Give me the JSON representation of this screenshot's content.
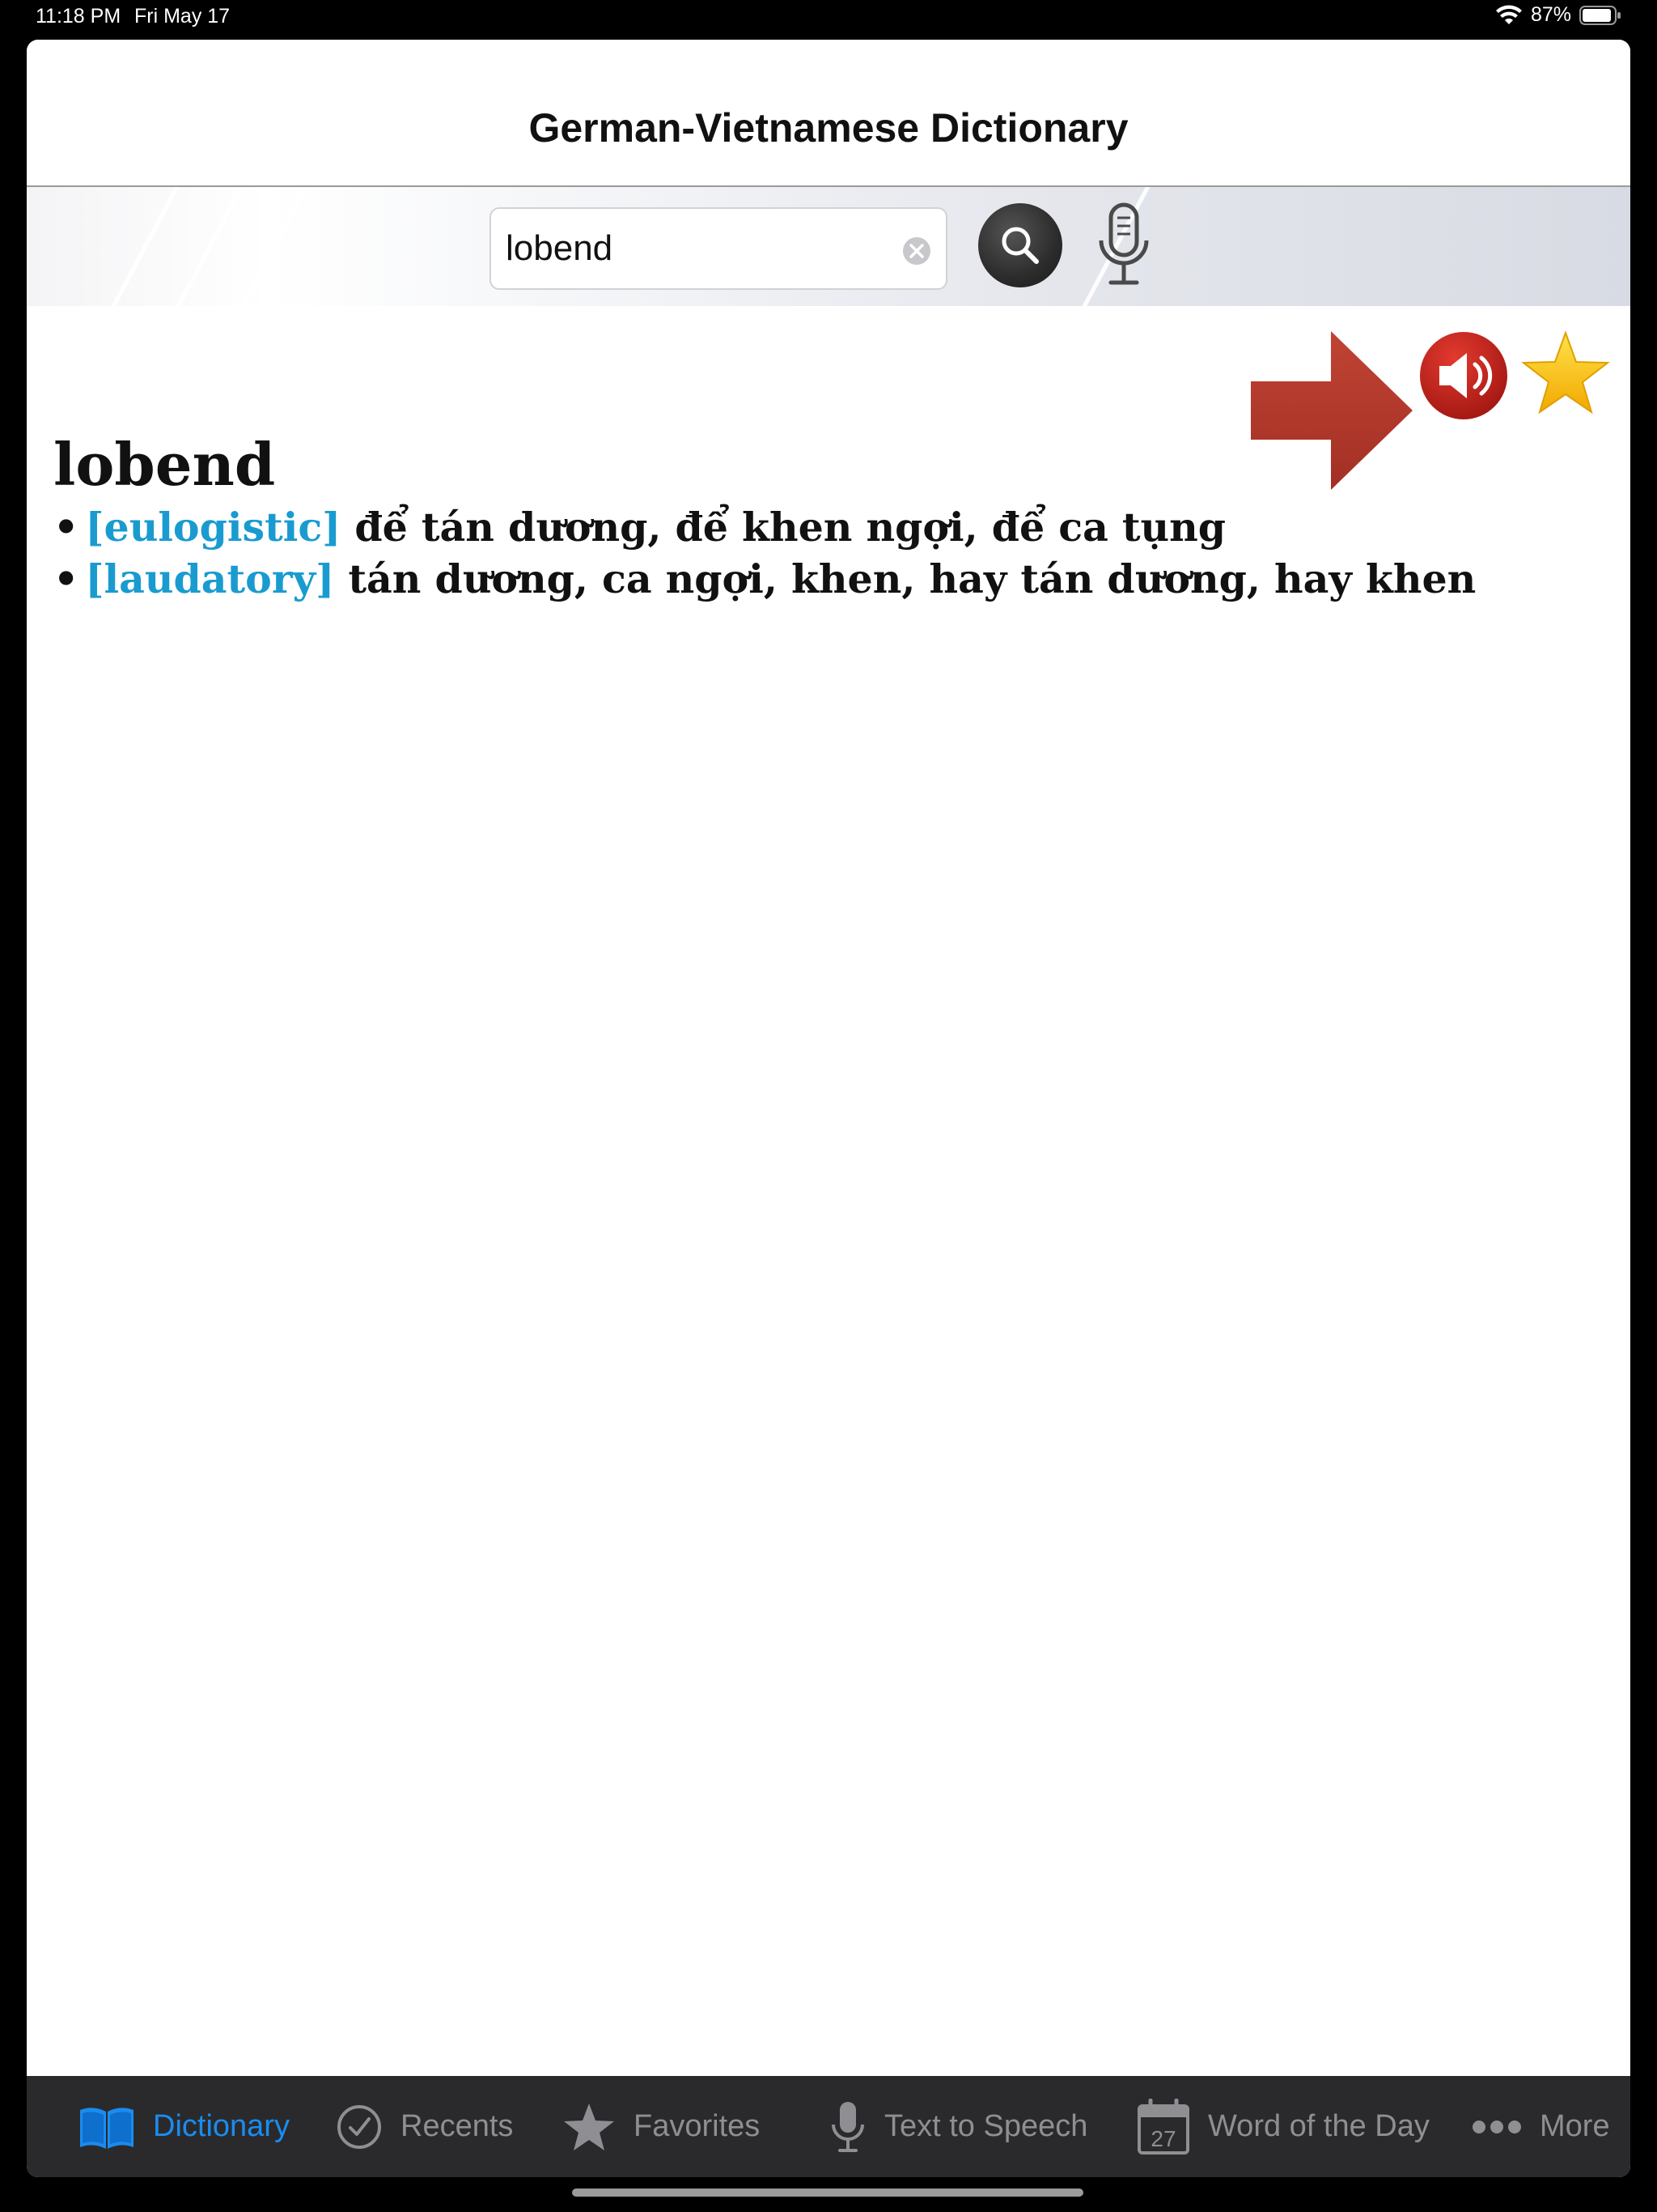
{
  "status_bar": {
    "time": "11:18 PM",
    "date": "Fri May 17",
    "battery": "87%"
  },
  "header": {
    "title": "German-Vietnamese Dictionary"
  },
  "search": {
    "value": "lobend"
  },
  "entry": {
    "headword": "lobend",
    "senses": [
      {
        "label": "[eulogistic]",
        "text": "để tán dương, để khen ngợi, để ca tụng"
      },
      {
        "label": "[laudatory]",
        "text": "tán dương, ca ngợi, khen, hay tán dương, hay khen"
      }
    ]
  },
  "tabs": [
    {
      "label": "Dictionary",
      "icon": "book-icon",
      "active": true
    },
    {
      "label": "Recents",
      "icon": "clock-check-icon",
      "active": false
    },
    {
      "label": "Favorites",
      "icon": "star-icon",
      "active": false
    },
    {
      "label": "Text to Speech",
      "icon": "mic-icon",
      "active": false
    },
    {
      "label": "Word of the Day",
      "icon": "calendar-icon",
      "calendar_day": "27",
      "active": false
    },
    {
      "label": "More",
      "icon": "more-dots-icon",
      "active": false
    }
  ],
  "colors": {
    "accent": "#1a8cf0",
    "label_blue": "#1a9bd0",
    "arrow_red": "#b33a2e",
    "speaker_red": "#c0221d",
    "star_yellow": "#f7c400",
    "tabbar_bg": "#2a2a2c"
  }
}
